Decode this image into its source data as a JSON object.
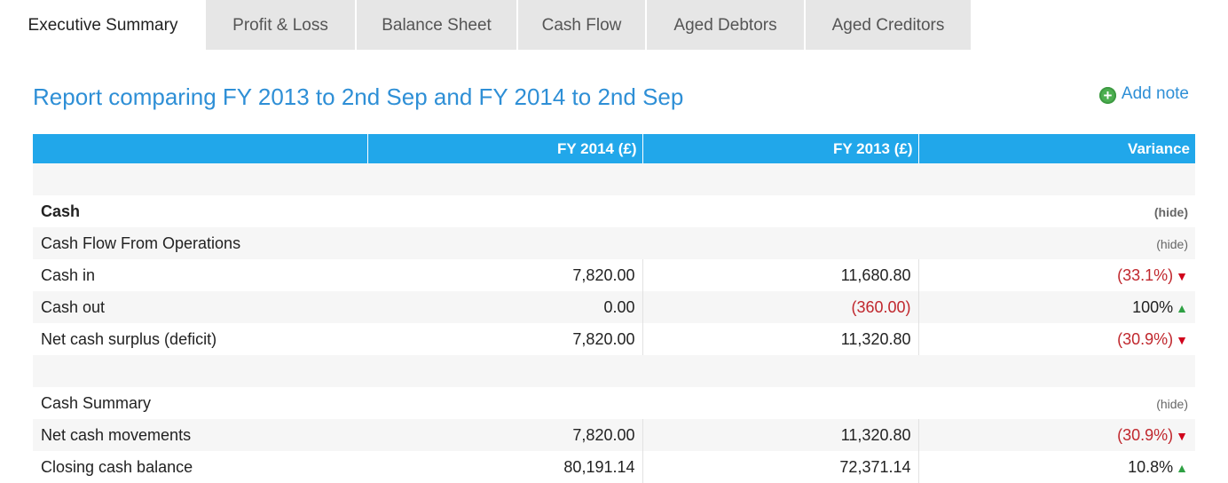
{
  "tabs": [
    {
      "label": "Executive Summary"
    },
    {
      "label": "Profit & Loss"
    },
    {
      "label": "Balance Sheet"
    },
    {
      "label": "Cash Flow"
    },
    {
      "label": "Aged Debtors"
    },
    {
      "label": "Aged Creditors"
    }
  ],
  "report": {
    "title": "Report comparing FY 2013 to 2nd Sep and FY 2014 to 2nd Sep",
    "add_note_label": "Add note",
    "columns": {
      "fy2014": "FY 2014 (£)",
      "fy2013": "FY 2013 (£)",
      "variance": "Variance"
    },
    "section_cash": {
      "label": "Cash",
      "hide": "(hide)"
    },
    "cfo": {
      "label": "Cash Flow From Operations",
      "hide": "(hide)"
    },
    "rows_ops": [
      {
        "label": "Cash in",
        "fy2014": "7,820.00",
        "fy2013": "11,680.80",
        "variance": "(33.1%)",
        "direction": "down"
      },
      {
        "label": "Cash out",
        "fy2014": "0.00",
        "fy2013": "(360.00)",
        "variance": "100%",
        "direction": "up"
      },
      {
        "label": "Net cash surplus (deficit)",
        "fy2014": "7,820.00",
        "fy2013": "11,320.80",
        "variance": "(30.9%)",
        "direction": "down"
      }
    ],
    "summary": {
      "label": "Cash Summary",
      "hide": "(hide)"
    },
    "rows_summary": [
      {
        "label": "Net cash movements",
        "fy2014": "7,820.00",
        "fy2013": "11,320.80",
        "variance": "(30.9%)",
        "direction": "down"
      },
      {
        "label": "Closing cash balance",
        "fy2014": "80,191.14",
        "fy2013": "72,371.14",
        "variance": "10.8%",
        "direction": "up"
      }
    ]
  },
  "colors": {
    "accent": "#2e8fd6",
    "header_bg": "#21a7ea",
    "negative": "#c0272d",
    "up": "#2ea043",
    "down": "#d0021b"
  }
}
